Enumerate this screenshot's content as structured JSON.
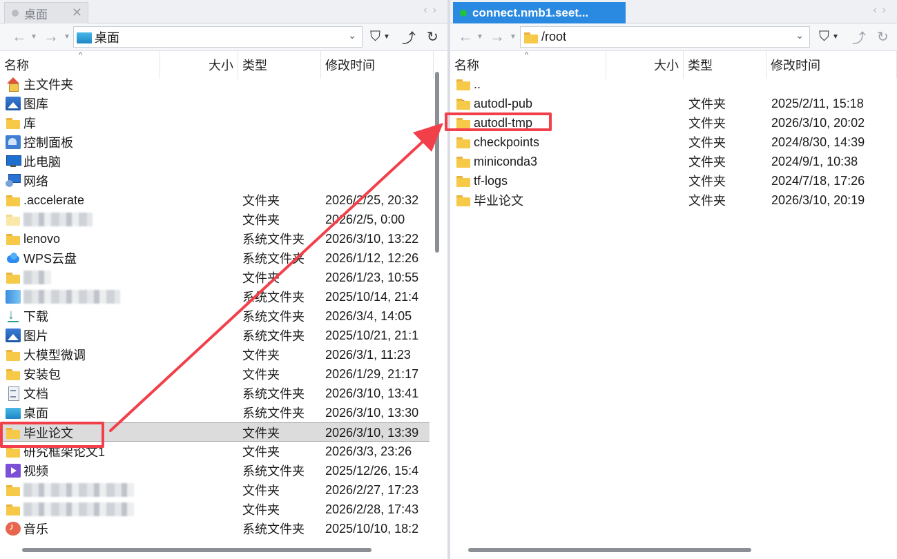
{
  "left": {
    "tab_title": "桌面",
    "path": "桌面",
    "columns": {
      "name": "名称",
      "size": "大小",
      "type": "类型",
      "modified": "修改时间"
    },
    "rows": [
      {
        "name": "主文件夹",
        "icon": "home-icon",
        "type": "",
        "modified": ""
      },
      {
        "name": "图库",
        "icon": "gallery-icon",
        "type": "",
        "modified": ""
      },
      {
        "name": "库",
        "icon": "folder-icon",
        "type": "",
        "modified": ""
      },
      {
        "name": "控制面板",
        "icon": "control-panel-icon",
        "type": "",
        "modified": ""
      },
      {
        "name": "此电脑",
        "icon": "computer-icon",
        "type": "",
        "modified": ""
      },
      {
        "name": "网络",
        "icon": "network-icon",
        "type": "",
        "modified": ""
      },
      {
        "name": ".accelerate",
        "icon": "folder-icon",
        "type": "文件夹",
        "modified": "2026/2/25, 20:32"
      },
      {
        "name": "",
        "icon": "blurred",
        "type": "文件夹",
        "modified": "2026/2/5, 0:00"
      },
      {
        "name": "lenovo",
        "icon": "folder-icon",
        "type": "系统文件夹",
        "modified": "2026/3/10, 13:22"
      },
      {
        "name": "WPS云盘",
        "icon": "cloud-icon",
        "type": "系统文件夹",
        "modified": "2026/1/12, 12:26"
      },
      {
        "name": "",
        "icon": "blurred-folder",
        "type": "文件夹",
        "modified": "2026/1/23, 10:55"
      },
      {
        "name": "",
        "icon": "blurred-app",
        "type": "系统文件夹",
        "modified": "2025/10/14, 21:4"
      },
      {
        "name": "下载",
        "icon": "download-icon",
        "type": "系统文件夹",
        "modified": "2026/3/4, 14:05"
      },
      {
        "name": "图片",
        "icon": "pictures-icon",
        "type": "系统文件夹",
        "modified": "2025/10/21, 21:1"
      },
      {
        "name": "大模型微调",
        "icon": "folder-icon",
        "type": "文件夹",
        "modified": "2026/3/1, 11:23"
      },
      {
        "name": "安装包",
        "icon": "folder-icon",
        "type": "文件夹",
        "modified": "2026/1/29, 21:17"
      },
      {
        "name": "文档",
        "icon": "document-icon",
        "type": "系统文件夹",
        "modified": "2026/3/10, 13:41"
      },
      {
        "name": "桌面",
        "icon": "desktop-icon",
        "type": "系统文件夹",
        "modified": "2026/3/10, 13:30"
      },
      {
        "name": "毕业论文",
        "icon": "folder-icon",
        "type": "文件夹",
        "modified": "2026/3/10, 13:39",
        "selected": true
      },
      {
        "name": "研究框架论文1",
        "icon": "folder-icon",
        "type": "文件夹",
        "modified": "2026/3/3, 23:26"
      },
      {
        "name": "视频",
        "icon": "video-icon",
        "type": "系统文件夹",
        "modified": "2025/12/26, 15:4"
      },
      {
        "name": "",
        "icon": "blurred-folder",
        "type": "文件夹",
        "modified": "2026/2/27, 17:23"
      },
      {
        "name": "",
        "icon": "blurred-folder",
        "type": "文件夹",
        "modified": "2026/2/28, 17:43"
      },
      {
        "name": "音乐",
        "icon": "music-icon",
        "type": "系统文件夹",
        "modified": "2025/10/10, 18:2"
      }
    ]
  },
  "right": {
    "tab_title": "connect.nmb1.seet...",
    "path": "/root",
    "columns": {
      "name": "名称",
      "size": "大小",
      "type": "类型",
      "modified": "修改时间"
    },
    "rows": [
      {
        "name": "..",
        "icon": "folder-icon",
        "type": "",
        "modified": ""
      },
      {
        "name": "autodl-pub",
        "icon": "folder-link-icon",
        "type": "文件夹",
        "modified": "2025/2/11, 15:18"
      },
      {
        "name": "autodl-tmp",
        "icon": "folder-icon",
        "type": "文件夹",
        "modified": "2026/3/10, 20:02"
      },
      {
        "name": "checkpoints",
        "icon": "folder-icon",
        "type": "文件夹",
        "modified": "2024/8/30, 14:39"
      },
      {
        "name": "miniconda3",
        "icon": "folder-icon",
        "type": "文件夹",
        "modified": "2024/9/1, 10:38"
      },
      {
        "name": "tf-logs",
        "icon": "folder-icon",
        "type": "文件夹",
        "modified": "2024/7/18, 17:26"
      },
      {
        "name": "毕业论文",
        "icon": "folder-icon",
        "type": "文件夹",
        "modified": "2026/3/10, 20:19"
      }
    ]
  },
  "colors": {
    "accent_tab": "#2a8ae2",
    "annotation_red": "#f2404a",
    "selected_row": "#dcdcdc"
  }
}
